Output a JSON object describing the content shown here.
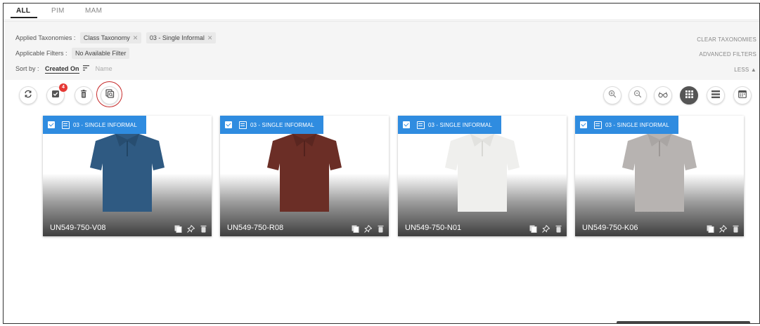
{
  "tabs": [
    {
      "label": "ALL",
      "active": true
    },
    {
      "label": "PIM",
      "active": false
    },
    {
      "label": "MAM",
      "active": false
    }
  ],
  "filters": {
    "applied_taxonomies_label": "Applied Taxonomies :",
    "taxonomy_chips": [
      "Class Taxonomy",
      "03 - Single Informal"
    ],
    "applicable_filters_label": "Applicable Filters :",
    "applicable_filter_value": "No Available Filter",
    "sort_label": "Sort by :",
    "sort_active": "Created On",
    "sort_other": "Name",
    "clear_taxonomies": "CLEAR TAXONOMIES",
    "advanced_filters": "ADVANCED FILTERS",
    "less": "LESS ▲"
  },
  "toolbar": {
    "left": [
      "refresh-icon",
      "select-all-icon",
      "delete-icon",
      "compare-icon"
    ],
    "selected_count": "4",
    "right": [
      "zoom-in-icon",
      "zoom-out-icon",
      "glasses-icon",
      "grid-view-icon",
      "list-view-icon",
      "calendar-icon"
    ]
  },
  "cards": [
    {
      "tag": "03 - SINGLE INFORMAL",
      "title": "UN549-750-V08",
      "color": "#2f5a82"
    },
    {
      "tag": "03 - SINGLE INFORMAL",
      "title": "UN549-750-R08",
      "color": "#6b2e26"
    },
    {
      "tag": "03 - SINGLE INFORMAL",
      "title": "UN549-750-N01",
      "color": "#efefed"
    },
    {
      "tag": "03 - SINGLE INFORMAL",
      "title": "UN549-750-K06",
      "color": "#b7b3b1"
    }
  ],
  "colors": {
    "accent": "#2f8ce0",
    "badge": "#e53935",
    "highlight": "#c62828"
  }
}
